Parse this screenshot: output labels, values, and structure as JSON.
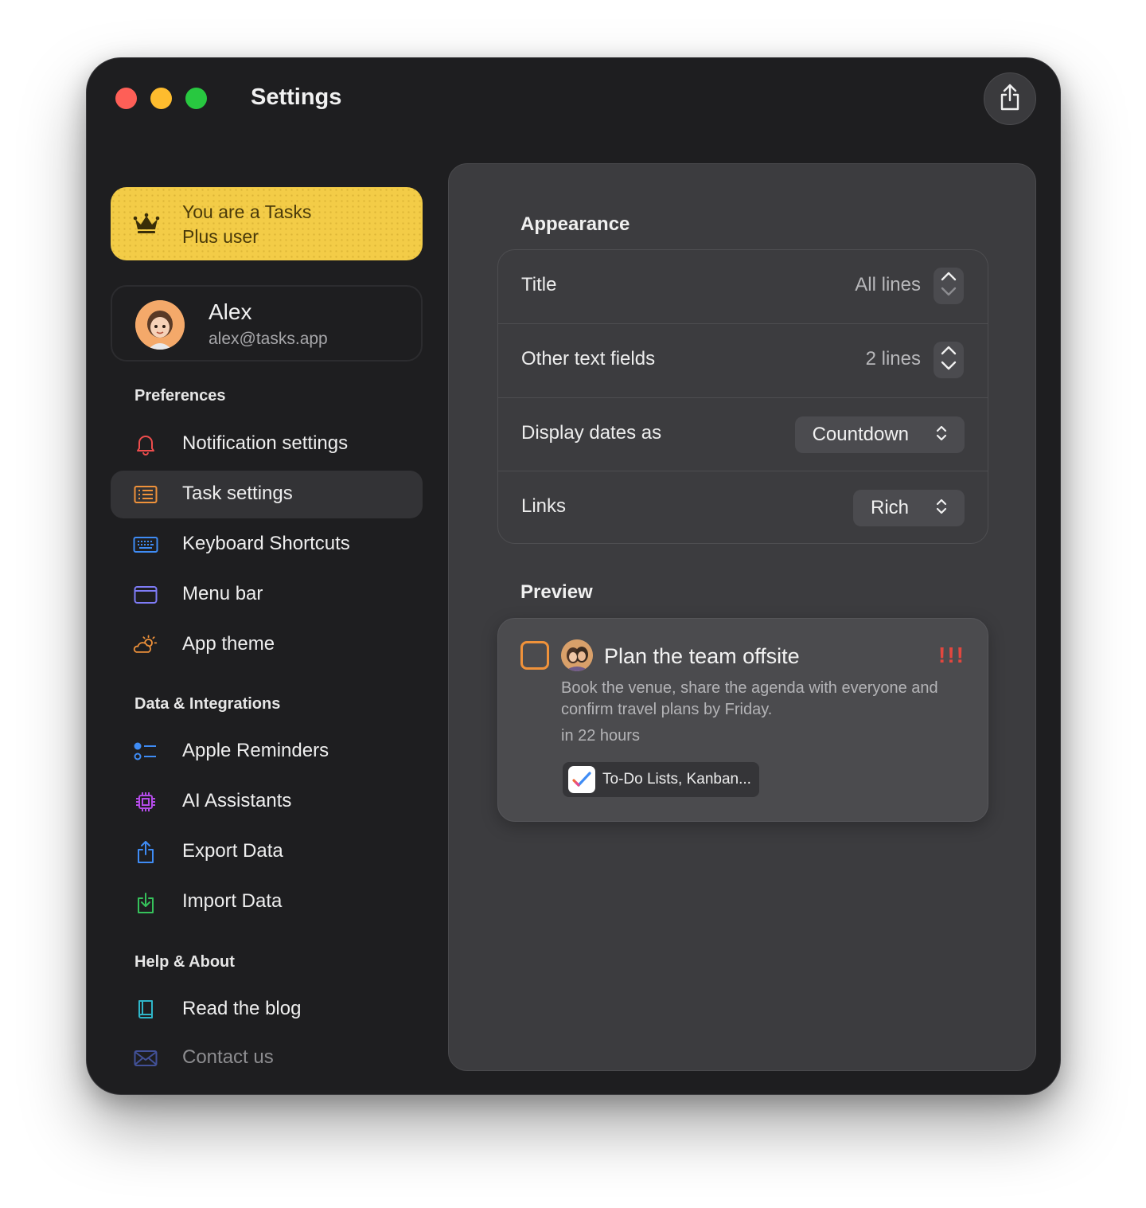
{
  "window": {
    "title": "Settings"
  },
  "plus_banner": {
    "text": "You are a Tasks Plus user"
  },
  "account": {
    "name": "Alex",
    "email": "alex@tasks.app"
  },
  "sidebar": {
    "sections": [
      {
        "header": "Preferences",
        "items": [
          {
            "label": "Notification settings",
            "icon": "bell-icon"
          },
          {
            "label": "Task settings",
            "icon": "task-list-icon",
            "active": true
          },
          {
            "label": "Keyboard Shortcuts",
            "icon": "keyboard-icon"
          },
          {
            "label": "Menu bar",
            "icon": "menu-bar-icon"
          },
          {
            "label": "App theme",
            "icon": "sun-cloud-icon"
          }
        ]
      },
      {
        "header": "Data & Integrations",
        "items": [
          {
            "label": "Apple Reminders",
            "icon": "reminders-list-icon"
          },
          {
            "label": "AI Assistants",
            "icon": "chip-icon"
          },
          {
            "label": "Export Data",
            "icon": "export-icon"
          },
          {
            "label": "Import Data",
            "icon": "import-icon"
          }
        ]
      },
      {
        "header": "Help & About",
        "items": [
          {
            "label": "Read the blog",
            "icon": "book-icon"
          },
          {
            "label": "Contact us",
            "icon": "envelope-icon"
          }
        ]
      }
    ]
  },
  "appearance": {
    "heading": "Appearance",
    "rows": [
      {
        "label": "Title",
        "value": "All lines",
        "control": "stepper"
      },
      {
        "label": "Other text fields",
        "value": "2 lines",
        "control": "stepper"
      },
      {
        "label": "Display dates as",
        "value": "Countdown",
        "control": "select"
      },
      {
        "label": "Links",
        "value": "Rich",
        "control": "select"
      }
    ]
  },
  "preview": {
    "heading": "Preview",
    "task": {
      "title": "Plan the team offsite",
      "priority": "!!!",
      "notes": "Book the venue, share the agenda with everyone and confirm travel plans by Friday.",
      "due": "in 22 hours",
      "tag": "To-Do Lists, Kanban..."
    }
  },
  "colors": {
    "window_bg": "#1e1e20",
    "panel_bg": "#3c3c3f",
    "plus_banner": "#f3cc47",
    "checkbox_orange": "#f0923a",
    "priority_red": "#e2473f"
  }
}
